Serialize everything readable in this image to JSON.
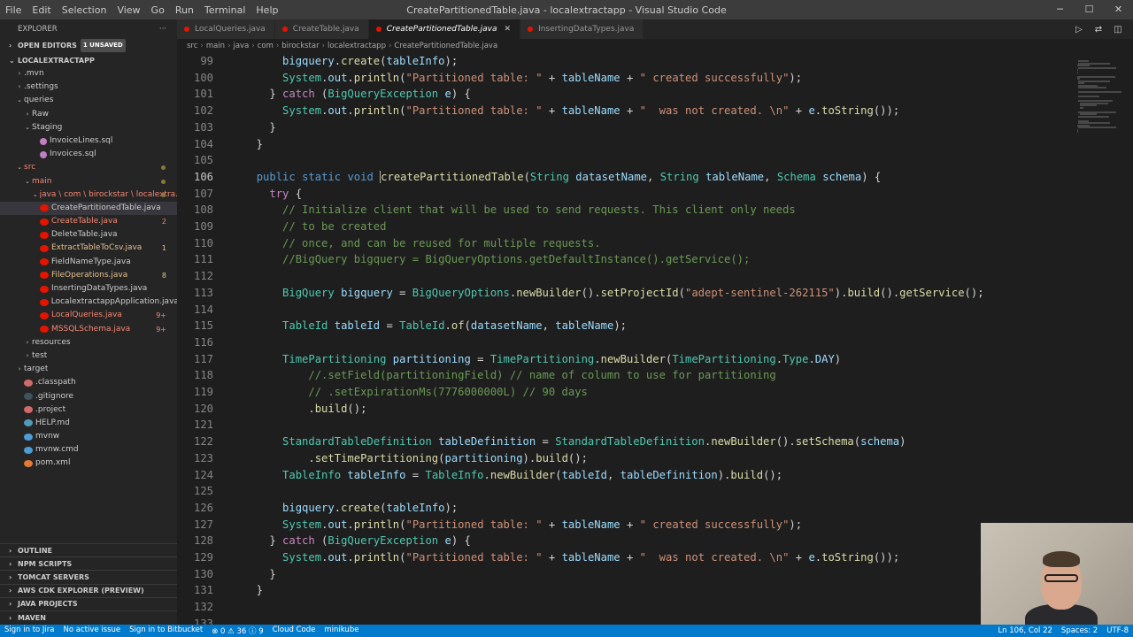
{
  "window": {
    "title": "CreatePartitionedTable.java - localextractapp - Visual Studio Code",
    "menu": [
      "File",
      "Edit",
      "Selection",
      "View",
      "Go",
      "Run",
      "Terminal",
      "Help"
    ]
  },
  "sidebar": {
    "header": "EXPLORER",
    "open_editors": "OPEN EDITORS",
    "unsaved_badge": "1 UNSAVED",
    "project": "LOCALEXTRACTAPP",
    "tree": [
      {
        "label": ".mvn",
        "indent": 1,
        "chev": "›",
        "kind": "folder",
        "color": "norm"
      },
      {
        "label": ".settings",
        "indent": 1,
        "chev": "›",
        "kind": "folder",
        "color": "norm"
      },
      {
        "label": "queries",
        "indent": 1,
        "chev": "⌄",
        "kind": "folder",
        "color": "norm"
      },
      {
        "label": "Raw",
        "indent": 2,
        "chev": "›",
        "kind": "folder",
        "color": "norm"
      },
      {
        "label": "Staging",
        "indent": 2,
        "chev": "⌄",
        "kind": "folder",
        "color": "norm"
      },
      {
        "label": "InvoiceLines.sql",
        "indent": 3,
        "chev": "",
        "kind": "sql",
        "color": "norm"
      },
      {
        "label": "Invoices.sql",
        "indent": 3,
        "chev": "",
        "kind": "sql",
        "color": "norm"
      },
      {
        "label": "src",
        "indent": 1,
        "chev": "⌄",
        "kind": "folder",
        "color": "err",
        "dot": true
      },
      {
        "label": "main",
        "indent": 2,
        "chev": "⌄",
        "kind": "folder",
        "color": "err",
        "dot": true
      },
      {
        "label": "java \\ com \\ birockstar \\ localextra...",
        "indent": 3,
        "chev": "⌄",
        "kind": "folder",
        "color": "err",
        "dot": true
      },
      {
        "label": "CreatePartitionedTable.java",
        "indent": 3,
        "chev": "",
        "kind": "java",
        "color": "norm",
        "selected": true
      },
      {
        "label": "CreateTable.java",
        "indent": 3,
        "chev": "",
        "kind": "java",
        "color": "err",
        "dec": "2"
      },
      {
        "label": "DeleteTable.java",
        "indent": 3,
        "chev": "",
        "kind": "java",
        "color": "norm"
      },
      {
        "label": "ExtractTableToCsv.java",
        "indent": 3,
        "chev": "",
        "kind": "java",
        "color": "mod",
        "dec": "1"
      },
      {
        "label": "FieldNameType.java",
        "indent": 3,
        "chev": "",
        "kind": "java",
        "color": "norm"
      },
      {
        "label": "FileOperations.java",
        "indent": 3,
        "chev": "",
        "kind": "java",
        "color": "mod",
        "dec": "8"
      },
      {
        "label": "InsertingDataTypes.java",
        "indent": 3,
        "chev": "",
        "kind": "java",
        "color": "norm"
      },
      {
        "label": "LocalextractappApplication.java",
        "indent": 3,
        "chev": "",
        "kind": "java",
        "color": "norm"
      },
      {
        "label": "LocalQueries.java",
        "indent": 3,
        "chev": "",
        "kind": "java",
        "color": "err",
        "dec": "9+"
      },
      {
        "label": "MSSQLSchema.java",
        "indent": 3,
        "chev": "",
        "kind": "java",
        "color": "err",
        "dec": "9+"
      },
      {
        "label": "resources",
        "indent": 2,
        "chev": "›",
        "kind": "folder",
        "color": "norm"
      },
      {
        "label": "test",
        "indent": 2,
        "chev": "›",
        "kind": "folder",
        "color": "norm"
      },
      {
        "label": "target",
        "indent": 1,
        "chev": "›",
        "kind": "folder",
        "color": "norm"
      },
      {
        "label": ".classpath",
        "indent": 1,
        "chev": "",
        "kind": "red",
        "color": "norm"
      },
      {
        "label": ".gitignore",
        "indent": 1,
        "chev": "",
        "kind": "git",
        "color": "norm"
      },
      {
        "label": ".project",
        "indent": 1,
        "chev": "",
        "kind": "red",
        "color": "norm"
      },
      {
        "label": "HELP.md",
        "indent": 1,
        "chev": "",
        "kind": "md",
        "color": "norm"
      },
      {
        "label": "mvnw",
        "indent": 1,
        "chev": "",
        "kind": "cmd",
        "color": "norm"
      },
      {
        "label": "mvnw.cmd",
        "indent": 1,
        "chev": "",
        "kind": "cmd",
        "color": "norm"
      },
      {
        "label": "pom.xml",
        "indent": 1,
        "chev": "",
        "kind": "xml",
        "color": "norm"
      }
    ],
    "bottom_sections": [
      "OUTLINE",
      "NPM SCRIPTS",
      "TOMCAT SERVERS",
      "AWS CDK EXPLORER (PREVIEW)",
      "JAVA PROJECTS",
      "MAVEN"
    ]
  },
  "tabs": [
    {
      "label": "LocalQueries.java",
      "active": false
    },
    {
      "label": "CreateTable.java",
      "active": false
    },
    {
      "label": "CreatePartitionedTable.java",
      "active": true
    },
    {
      "label": "InsertingDataTypes.java",
      "active": false
    }
  ],
  "breadcrumb": [
    "src",
    "main",
    "java",
    "com",
    "birockstar",
    "localextractapp",
    "CreatePartitionedTable.java"
  ],
  "editor": {
    "current_line": 106,
    "lines": [
      {
        "n": 99,
        "html": "      <span class='vr'>bigquery</span>.<span class='fn'>create</span>(<span class='vr'>tableInfo</span>);"
      },
      {
        "n": 100,
        "html": "      <span class='ty'>System</span>.<span class='vr'>out</span>.<span class='fn'>println</span>(<span class='st'>\"Partitioned table: \"</span> + <span class='vr'>tableName</span> + <span class='st'>\" created successfully\"</span>);"
      },
      {
        "n": 101,
        "html": "    } <span class='kw2'>catch</span> (<span class='ty'>BigQueryException</span> <span class='vr'>e</span>) {"
      },
      {
        "n": 102,
        "html": "      <span class='ty'>System</span>.<span class='vr'>out</span>.<span class='fn'>println</span>(<span class='st'>\"Partitioned table: \"</span> + <span class='vr'>tableName</span> + <span class='st'>\"  was not created. \\n\"</span> + <span class='vr'>e</span>.<span class='fn'>toString</span>());"
      },
      {
        "n": 103,
        "html": "    }"
      },
      {
        "n": 104,
        "html": "  }"
      },
      {
        "n": 105,
        "html": ""
      },
      {
        "n": 106,
        "html": "  <span class='kw'>public</span> <span class='kw'>static</span> <span class='kw'>void</span> <span class='cursor'></span><span class='fn'>createPartitionedTable</span>(<span class='ty'>String</span> <span class='vr'>datasetName</span>, <span class='ty'>String</span> <span class='vr'>tableName</span>, <span class='ty'>Schema</span> <span class='vr'>schema</span>) {"
      },
      {
        "n": 107,
        "html": "    <span class='kw2'>try</span> {"
      },
      {
        "n": 108,
        "html": "      <span class='cm'>// Initialize client that will be used to send requests. This client only needs</span>"
      },
      {
        "n": 109,
        "html": "      <span class='cm'>// to be created</span>"
      },
      {
        "n": 110,
        "html": "      <span class='cm'>// once, and can be reused for multiple requests.</span>"
      },
      {
        "n": 111,
        "html": "      <span class='cm'>//BigQuery bigquery = BigQueryOptions.getDefaultInstance().getService();</span>"
      },
      {
        "n": 112,
        "html": ""
      },
      {
        "n": 113,
        "html": "      <span class='ty'>BigQuery</span> <span class='vr'>bigquery</span> = <span class='ty'>BigQueryOptions</span>.<span class='fn'>newBuilder</span>().<span class='fn'>setProjectId</span>(<span class='st'>\"adept-sentinel-262115\"</span>).<span class='fn'>build</span>().<span class='fn'>getService</span>();"
      },
      {
        "n": 114,
        "html": ""
      },
      {
        "n": 115,
        "html": "      <span class='ty'>TableId</span> <span class='vr'>tableId</span> = <span class='ty'>TableId</span>.<span class='fn'>of</span>(<span class='vr'>datasetName</span>, <span class='vr'>tableName</span>);"
      },
      {
        "n": 116,
        "html": ""
      },
      {
        "n": 117,
        "html": "      <span class='ty'>TimePartitioning</span> <span class='vr'>partitioning</span> = <span class='ty'>TimePartitioning</span>.<span class='fn'>newBuilder</span>(<span class='ty'>TimePartitioning</span>.<span class='ty'>Type</span>.<span class='vr'>DAY</span>)"
      },
      {
        "n": 118,
        "html": "          <span class='cm'>//.setField(partitioningField) // name of column to use for partitioning</span>"
      },
      {
        "n": 119,
        "html": "          <span class='cm'>// .setExpirationMs(7776000000L) // 90 days</span>"
      },
      {
        "n": 120,
        "html": "          .<span class='fn'>build</span>();"
      },
      {
        "n": 121,
        "html": ""
      },
      {
        "n": 122,
        "html": "      <span class='ty'>StandardTableDefinition</span> <span class='vr'>tableDefinition</span> = <span class='ty'>StandardTableDefinition</span>.<span class='fn'>newBuilder</span>().<span class='fn'>setSchema</span>(<span class='vr'>schema</span>)"
      },
      {
        "n": 123,
        "html": "          .<span class='fn'>setTimePartitioning</span>(<span class='vr'>partitioning</span>).<span class='fn'>build</span>();"
      },
      {
        "n": 124,
        "html": "      <span class='ty'>TableInfo</span> <span class='vr'>tableInfo</span> = <span class='ty'>TableInfo</span>.<span class='fn'>newBuilder</span>(<span class='vr'>tableId</span>, <span class='vr'>tableDefinition</span>).<span class='fn'>build</span>();"
      },
      {
        "n": 125,
        "html": ""
      },
      {
        "n": 126,
        "html": "      <span class='vr'>bigquery</span>.<span class='fn'>create</span>(<span class='vr'>tableInfo</span>);"
      },
      {
        "n": 127,
        "html": "      <span class='ty'>System</span>.<span class='vr'>out</span>.<span class='fn'>println</span>(<span class='st'>\"Partitioned table: \"</span> + <span class='vr'>tableName</span> + <span class='st'>\" created successfully\"</span>);"
      },
      {
        "n": 128,
        "html": "    } <span class='kw2'>catch</span> (<span class='ty'>BigQueryException</span> <span class='vr'>e</span>) {"
      },
      {
        "n": 129,
        "html": "      <span class='ty'>System</span>.<span class='vr'>out</span>.<span class='fn'>println</span>(<span class='st'>\"Partitioned table: \"</span> + <span class='vr'>tableName</span> + <span class='st'>\"  was not created. \\n\"</span> + <span class='vr'>e</span>.<span class='fn'>toString</span>());"
      },
      {
        "n": 130,
        "html": "    }"
      },
      {
        "n": 131,
        "html": "  }"
      },
      {
        "n": 132,
        "html": ""
      },
      {
        "n": 133,
        "html": ""
      }
    ]
  },
  "statusbar": {
    "left": [
      "Sign in to Jira",
      "No active issue",
      "Sign in to Bitbucket",
      "⊗ 0 ⚠ 36 ⓘ 9",
      "Cloud Code",
      "minikube"
    ],
    "right": [
      "Ln 106, Col 22",
      "Spaces: 2",
      "UTF-8"
    ]
  },
  "colors": {
    "accent": "#007acc",
    "editor_bg": "#1e1e1e",
    "sidebar_bg": "#252526"
  }
}
